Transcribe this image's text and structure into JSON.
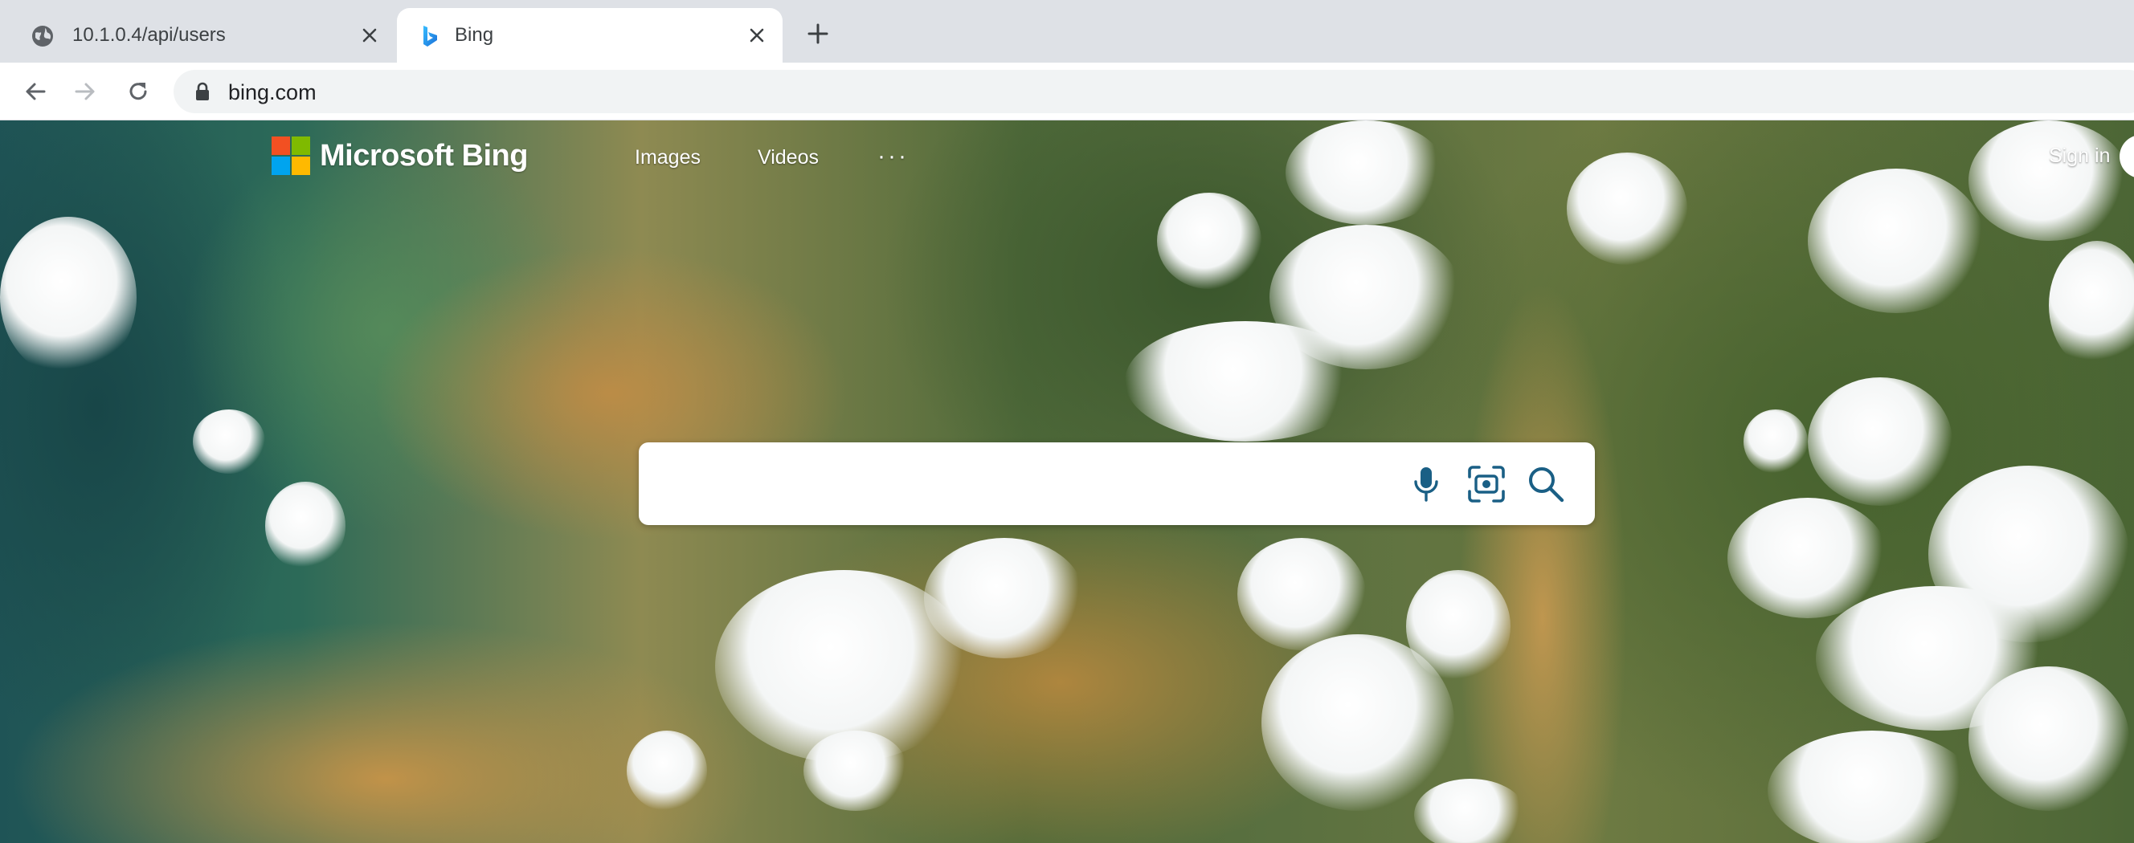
{
  "browser": {
    "tabs": [
      {
        "title": "10.1.0.4/api/users",
        "favicon": "globe-icon",
        "active": false
      },
      {
        "title": "Bing",
        "favicon": "bing-icon",
        "active": true
      }
    ],
    "address_bar": {
      "url": "bing.com",
      "secure_icon": "lock-icon"
    }
  },
  "bing": {
    "logo_text": "Microsoft Bing",
    "logo_colors": [
      "#f25022",
      "#7fba00",
      "#00a4ef",
      "#ffb900"
    ],
    "nav": {
      "images": "Images",
      "videos": "Videos",
      "more": "···"
    },
    "sign_in": "Sign in",
    "search": {
      "value": "",
      "placeholder": "",
      "accent_color": "#1a5f85"
    }
  }
}
